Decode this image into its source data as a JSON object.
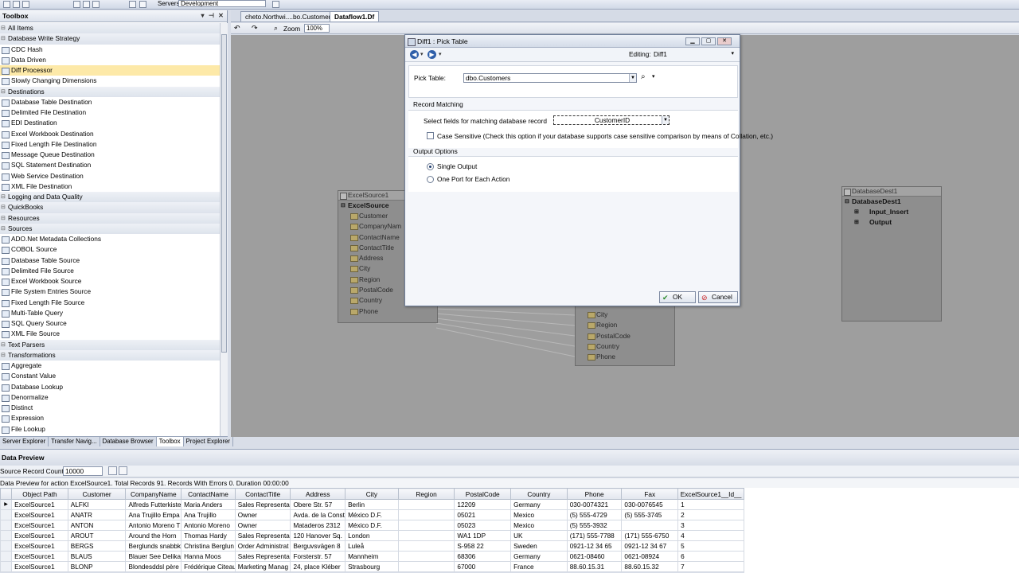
{
  "topbar": {
    "servers_label": "Servers",
    "servers_value": "Development"
  },
  "toolbox": {
    "title": "Toolbox",
    "items": [
      {
        "label": "All Items",
        "kind": "cat"
      },
      {
        "label": "Database Write Strategy",
        "kind": "cat"
      },
      {
        "label": "CDC Hash",
        "kind": "item"
      },
      {
        "label": "Data Driven",
        "kind": "item"
      },
      {
        "label": "Diff Processor",
        "kind": "item",
        "selected": true
      },
      {
        "label": "Slowly Changing Dimensions",
        "kind": "item"
      },
      {
        "label": "Destinations",
        "kind": "cat"
      },
      {
        "label": "Database Table Destination",
        "kind": "item"
      },
      {
        "label": "Delimited File Destination",
        "kind": "item"
      },
      {
        "label": "EDI Destination",
        "kind": "item"
      },
      {
        "label": "Excel Workbook Destination",
        "kind": "item"
      },
      {
        "label": "Fixed Length File Destination",
        "kind": "item"
      },
      {
        "label": "Message Queue Destination",
        "kind": "item"
      },
      {
        "label": "SQL Statement Destination",
        "kind": "item"
      },
      {
        "label": "Web Service Destination",
        "kind": "item"
      },
      {
        "label": "XML File Destination",
        "kind": "item"
      },
      {
        "label": "Logging and Data Quality",
        "kind": "cat"
      },
      {
        "label": "QuickBooks",
        "kind": "cat"
      },
      {
        "label": "Resources",
        "kind": "cat"
      },
      {
        "label": "Sources",
        "kind": "cat"
      },
      {
        "label": "ADO.Net Metadata Collections",
        "kind": "item"
      },
      {
        "label": "COBOL Source",
        "kind": "item"
      },
      {
        "label": "Database Table Source",
        "kind": "item"
      },
      {
        "label": "Delimited File Source",
        "kind": "item"
      },
      {
        "label": "Excel Workbook Source",
        "kind": "item"
      },
      {
        "label": "File System Entries Source",
        "kind": "item"
      },
      {
        "label": "Fixed Length File Source",
        "kind": "item"
      },
      {
        "label": "Multi-Table Query",
        "kind": "item"
      },
      {
        "label": "SQL Query Source",
        "kind": "item"
      },
      {
        "label": "XML File Source",
        "kind": "item"
      },
      {
        "label": "Text Parsers",
        "kind": "cat"
      },
      {
        "label": "Transformations",
        "kind": "cat"
      },
      {
        "label": "Aggregate",
        "kind": "item"
      },
      {
        "label": "Constant Value",
        "kind": "item"
      },
      {
        "label": "Database Lookup",
        "kind": "item"
      },
      {
        "label": "Denormalize",
        "kind": "item"
      },
      {
        "label": "Distinct",
        "kind": "item"
      },
      {
        "label": "Expression",
        "kind": "item"
      },
      {
        "label": "File Lookup",
        "kind": "item"
      }
    ]
  },
  "left_tabs": [
    "Server Explorer",
    "Transfer Navig...",
    "Database Browser",
    "Toolbox",
    "Project Explorer"
  ],
  "doc_tabs": [
    "cheto.Northwi....bo.Customers",
    "Dataflow1.Df"
  ],
  "doc_toolbar": {
    "zoom_label": "Zoom",
    "zoom_value": "100%"
  },
  "canvas": {
    "excel_source": {
      "header": "ExcelSource1",
      "title": "ExcelSource",
      "fields": [
        "Customer",
        "CompanyNam",
        "ContactName",
        "ContactTitle",
        "Address",
        "City",
        "Region",
        "PostalCode",
        "Country",
        "Phone"
      ]
    },
    "middle_node": {
      "fields": [
        "City",
        "Region",
        "PostalCode",
        "Country",
        "Phone"
      ]
    },
    "db_dest": {
      "header": "DatabaseDest1",
      "title": "DatabaseDest1",
      "ports": [
        "Input_Insert",
        "Output"
      ]
    }
  },
  "dialog": {
    "title": "Diff1 : Pick Table",
    "editing_label": "Editing:",
    "editing_value": "Diff1",
    "pick_table_label": "Pick Table:",
    "pick_table_value": "dbo.Customers",
    "record_matching_label": "Record Matching",
    "select_fields_label": "Select fields for matching database record",
    "select_fields_value": "CustomerID",
    "case_sensitive_label": "Case Sensitive (Check this option if your database supports case sensitive comparison by means of Collation, etc.)",
    "output_options_label": "Output Options",
    "single_output_label": "Single Output",
    "one_port_label": "One Port for Each Action",
    "ok_label": "OK",
    "cancel_label": "Cancel"
  },
  "data_preview": {
    "title": "Data Preview",
    "source_record_count_label": "Source Record Count",
    "source_record_count_value": "10000",
    "status": "Data Preview for action ExcelSource1. Total Records 91. Records With Errors 0. Duration 00:00:00",
    "columns": [
      "Object Path",
      "Customer",
      "CompanyName",
      "ContactName",
      "ContactTitle",
      "Address",
      "City",
      "Region",
      "PostalCode",
      "Country",
      "Phone",
      "Fax",
      "ExcelSource1__Id__"
    ],
    "rows": [
      [
        "ExcelSource1",
        "ALFKI",
        "Alfreds Futterkiste",
        "Maria Anders",
        "Sales Representa",
        "Obere Str. 57",
        "Berlin",
        "",
        "12209",
        "Germany",
        "030-0074321",
        "030-0076545",
        "1"
      ],
      [
        "ExcelSource1",
        "ANATR",
        "Ana Trujillo Empa",
        "Ana Trujillo",
        "Owner",
        "Avda. de la Const",
        "México D.F.",
        "",
        "05021",
        "Mexico",
        "(5) 555-4729",
        "(5) 555-3745",
        "2"
      ],
      [
        "ExcelSource1",
        "ANTON",
        "Antonio Moreno T",
        "Antonio Moreno",
        "Owner",
        "Mataderos  2312",
        "México D.F.",
        "",
        "05023",
        "Mexico",
        "(5) 555-3932",
        "",
        "3"
      ],
      [
        "ExcelSource1",
        "AROUT",
        "Around the Horn",
        "Thomas Hardy",
        "Sales Representa",
        "120 Hanover Sq.",
        "London",
        "",
        "WA1 1DP",
        "UK",
        "(171) 555-7788",
        "(171) 555-6750",
        "4"
      ],
      [
        "ExcelSource1",
        "BERGS",
        "Berglunds snabbk",
        "Christina Berglun",
        "Order Administrat",
        "Berguvsvägen  8",
        "Luleå",
        "",
        "S-958 22",
        "Sweden",
        "0921-12 34 65",
        "0921-12 34 67",
        "5"
      ],
      [
        "ExcelSource1",
        "BLAUS",
        "Blauer See Delika",
        "Hanna Moos",
        "Sales Representa",
        "Forsterstr. 57",
        "Mannheim",
        "",
        "68306",
        "Germany",
        "0621-08460",
        "0621-08924",
        "6"
      ],
      [
        "ExcelSource1",
        "BLONP",
        "Blondesddsl père",
        "Frédérique Citeau",
        "Marketing Manag",
        "24, place Kléber",
        "Strasbourg",
        "",
        "67000",
        "France",
        "88.60.15.31",
        "88.60.15.32",
        "7"
      ]
    ]
  }
}
